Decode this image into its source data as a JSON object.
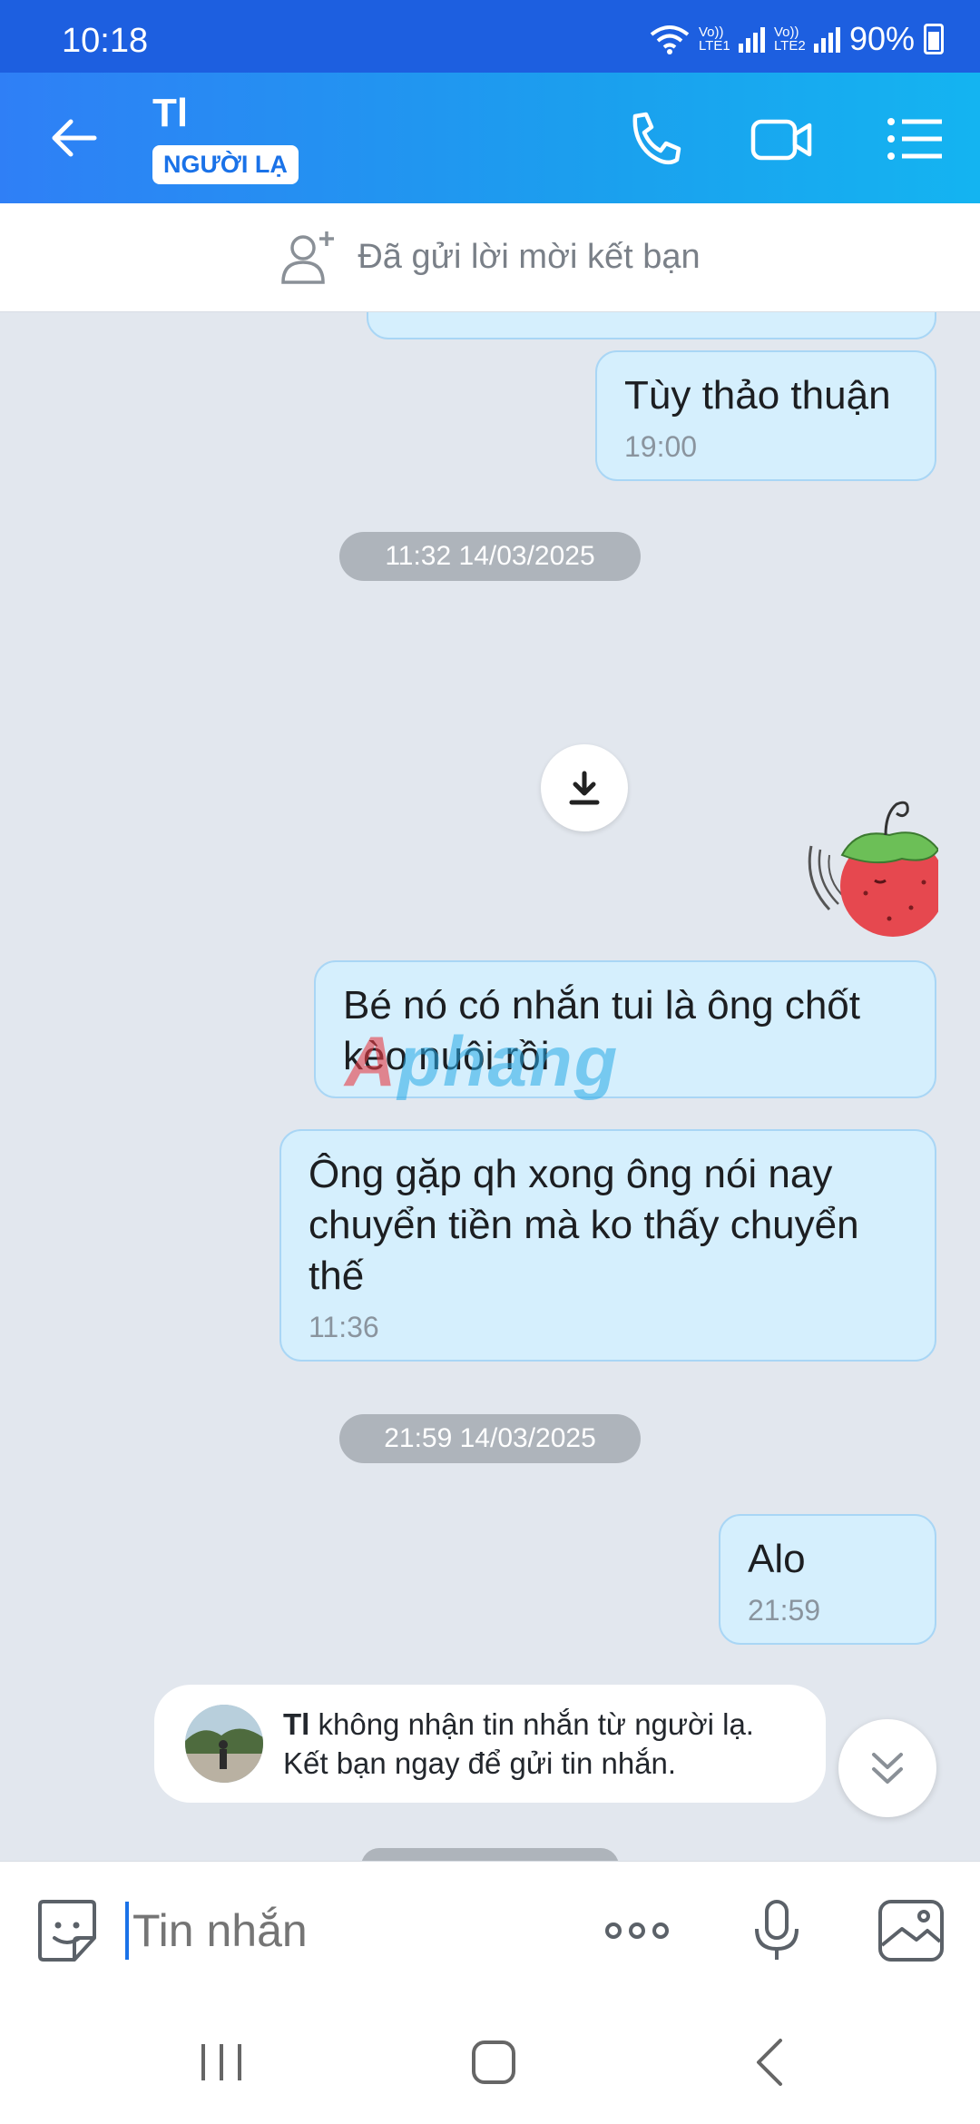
{
  "status_bar": {
    "time": "10:18",
    "sim1_label": "Vo)) LTE1",
    "sim2_label": "Vo)) LTE2",
    "battery": "90%"
  },
  "header": {
    "contact_name": "Tl",
    "badge": "NGƯỜI LẠ",
    "icons": [
      "back-arrow-icon",
      "phone-icon",
      "video-call-icon",
      "menu-icon"
    ]
  },
  "friend_request": {
    "text": "Đã gửi lời mời kết bạn"
  },
  "messages": [
    {
      "text": "Tùy thảo thuận",
      "time": "19:00"
    },
    {
      "date_chip": "11:32 14/03/2025"
    },
    {
      "text": "Bé nó có nhắn tui là ông chốt kèo nuôi rồi",
      "time": ""
    },
    {
      "text": "Ông gặp qh xong ông nói nay chuyển tiền mà ko thấy chuyển thế",
      "time": "11:36"
    },
    {
      "date_chip": "21:59 14/03/2025"
    },
    {
      "text": "Alo",
      "time": "21:59"
    }
  ],
  "watermark": {
    "a": "A",
    "rest": "phang"
  },
  "notice": {
    "name": "Tl",
    "line1_rest": " không nhận tin nhắn từ người lạ.",
    "line2": "Kết bạn ngay để gửi tin nhắn."
  },
  "input": {
    "placeholder": "Tin nhắn"
  },
  "colors": {
    "header_start": "#2f7ff6",
    "header_end": "#14b4f1",
    "bubble_bg": "#d5effd",
    "chat_bg": "#e2e7ee"
  }
}
